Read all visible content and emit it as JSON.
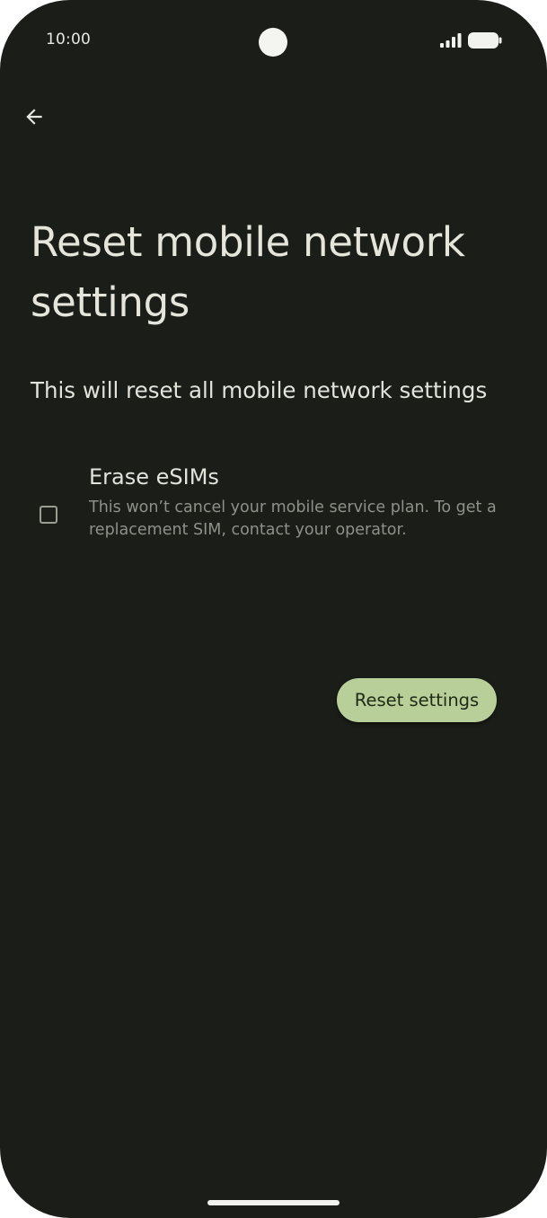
{
  "status_bar": {
    "time": "10:00"
  },
  "header": {
    "back_icon": "arrow-back-icon"
  },
  "page": {
    "title": "Reset mobile network settings",
    "subtitle": "This will reset all mobile network settings"
  },
  "options": [
    {
      "title": "Erase eSIMs",
      "summary": "This won’t cancel your mobile service plan. To get a replacement SIM, contact your operator.",
      "checked": false
    }
  ],
  "actions": {
    "reset_label": "Reset settings"
  },
  "colors": {
    "background": "#1b1e18",
    "accent_button": "#b8cf9a",
    "text_primary": "#e3e3dc",
    "text_secondary": "#8e9188"
  }
}
